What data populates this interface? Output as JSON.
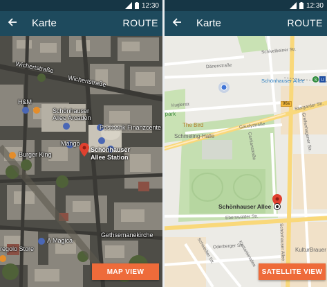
{
  "status_bar": {
    "time": "12:30",
    "icons": [
      "signal-icon",
      "battery-icon"
    ]
  },
  "left_screen": {
    "title": "Karte",
    "route_label": "ROUTE",
    "button_label": "MAP VIEW",
    "labels": {
      "wichertstrasse_1": "Wichertstraße",
      "wichertstrasse_2": "Wichertstraße",
      "hm": "H&M",
      "arcaden_1": "Schönhauser",
      "arcaden_2": "Allee Arcaden",
      "postbank": "Postbank Finanzcente",
      "mango": "Mango",
      "station_1": "Schönhauser",
      "station_2": "Allee Station",
      "burger_king": "Burger King",
      "regolo": "regolo Store",
      "amagica": "A Magica",
      "gethsemane": "Gethsemanekirche"
    }
  },
  "right_screen": {
    "title": "Karte",
    "route_label": "ROUTE",
    "button_label": "SATELLITE VIEW",
    "labels": {
      "schivelbeiner": "Schivelbeiner Str.",
      "daenen": "Dänenstraße",
      "kuglerstr": "Kuglerstr.",
      "schonhauser_top": "Schönhauser Allee",
      "park": "rpark",
      "route_96a": "96a",
      "stargarder": "Stargarder Str.",
      "the_bird": "The Bird",
      "gaudy": "Gaudystraße",
      "schmeling": "Schmeling-Halle",
      "cantian": "Cantianstraße",
      "greifenhagener": "Greifenhagener Str.",
      "station": "Schönhauser Allee",
      "eberswalder": "Eberswalder Str.",
      "schonhauser_allee_v": "Schönhauser Allee",
      "schwedter": "Schwedter Str.",
      "oderberger": "Oderberger Str.",
      "kastanien": "Kastanienallee",
      "kulturbrauerei": "KulturBrauer"
    }
  },
  "colors": {
    "status_bar": "#163645",
    "app_bar": "#1e4a5d",
    "accent": "#ee6b3a",
    "pin": "#e0412f"
  }
}
